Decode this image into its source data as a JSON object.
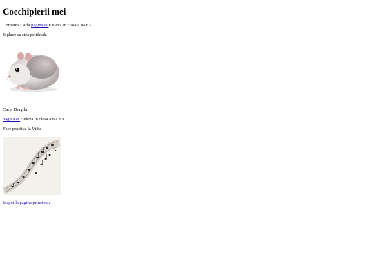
{
  "page": {
    "title": "Coechipierii mei"
  },
  "members": [
    {
      "intro_prefix": "Coroama Carla ",
      "link_text": "pagina ei ",
      "intro_suffix": "F eleva in clasa a 8a E3.",
      "hobby": "Ii place sa stea pe tiktok.",
      "photo_icon": "hamster-photo"
    },
    {
      "name": "Carla Dragila",
      "link_text": "pagina ei ",
      "intro_suffix": "F eleva in clasa a 8 a E3.",
      "hobby": "Face practica la Vidu.",
      "photo_icon": "music-notes-photo"
    }
  ],
  "footer": {
    "back_link": "Inapoi la pagina principala"
  },
  "colors": {
    "link": "#1a0dab",
    "text": "#000000",
    "background": "#ffffff"
  }
}
